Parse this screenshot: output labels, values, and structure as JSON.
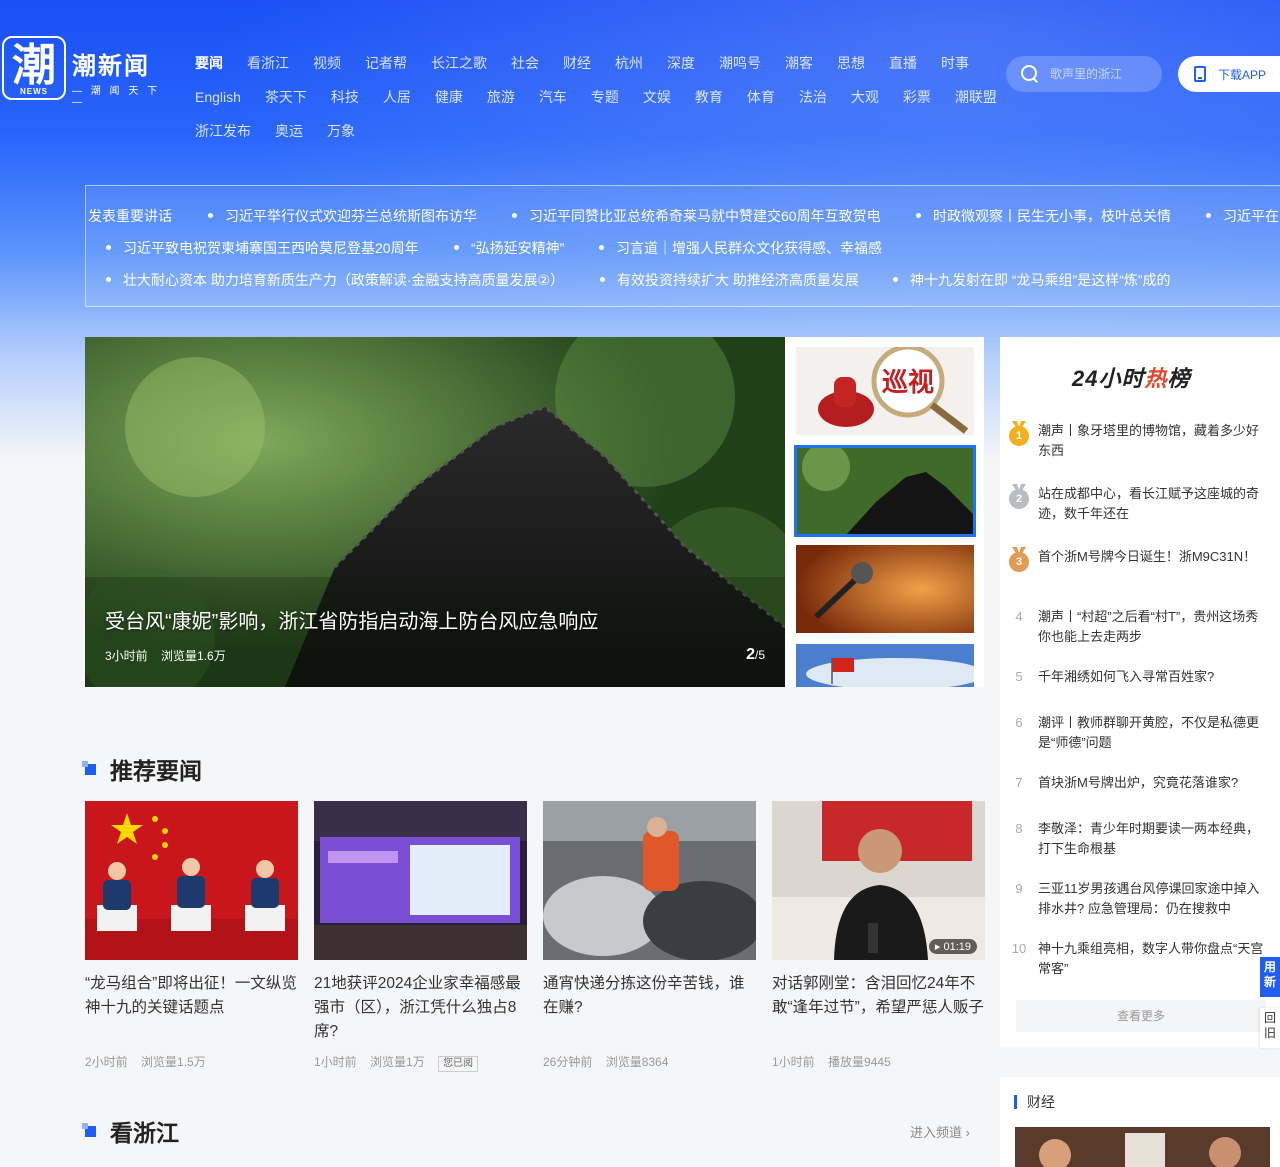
{
  "brand": {
    "logo_char": "潮",
    "logo_tag": "NEWS",
    "name": "潮新闻",
    "slogan": "— 潮 闻 天 下 —"
  },
  "nav": {
    "row1": [
      "要闻",
      "看浙江",
      "视频",
      "记者帮",
      "长江之歌",
      "社会",
      "财经",
      "杭州",
      "深度",
      "潮鸣号",
      "潮客",
      "思想",
      "直播",
      "时事"
    ],
    "row2": [
      "English",
      "茶天下",
      "科技",
      "人居",
      "健康",
      "旅游",
      "汽车",
      "专题",
      "文娱",
      "教育",
      "体育",
      "法治",
      "大观",
      "彩票",
      "潮联盟"
    ],
    "row3": [
      "浙江发布",
      "奥运",
      "万象"
    ],
    "active": "要闻"
  },
  "search": {
    "placeholder": "歌声里的浙江"
  },
  "download": {
    "label": "下载APP"
  },
  "ticker": {
    "row1": [
      "发表重要讲话",
      "习近平举行仪式欢迎芬兰总统斯图布访华",
      "习近平同赞比亚总统希奇莱马就中赞建交60周年互致贺电",
      "时政微观察丨民生无小事，枝叶总关情",
      "习近平在"
    ],
    "row2": [
      "习近平致电祝贺柬埔寨国王西哈莫尼登基20周年",
      "“弘扬延安精神”",
      "习言道｜增强人民群众文化获得感、幸福感"
    ],
    "row3": [
      "壮大耐心资本 助力培育新质生产力（政策解读·金融支持高质量发展②）",
      "有效投资持续扩大 助推经济高质量发展",
      "神十九发射在即 “龙马乘组”是这样“炼”成的"
    ]
  },
  "carousel": {
    "title": "受台风“康妮”影响，浙江省防指启动海上防台风应急响应",
    "time": "3小时前",
    "views": "浏览量1.6万",
    "page_current": "2",
    "page_total": "/5",
    "thumb1_text": "巡视"
  },
  "recommend": {
    "heading": "推荐要闻",
    "cards": [
      {
        "title": "“龙马组合”即将出征！一文纵览神十九的关键话题点",
        "time": "2小时前",
        "stat": "浏览量1.5万",
        "badge": "",
        "duration": ""
      },
      {
        "title": "21地获评2024企业家幸福感最强市（区），浙江凭什么独占8席?",
        "time": "1小时前",
        "stat": "浏览量1万",
        "badge": "您已阅",
        "duration": ""
      },
      {
        "title": "通宵快递分拣这份辛苦钱，谁在赚?",
        "time": "26分钟前",
        "stat": "浏览量8364",
        "badge": "",
        "duration": ""
      },
      {
        "title": "对话郭刚堂：含泪回忆24年不敢“逢年过节”，希望严惩人贩子",
        "time": "1小时前",
        "stat": "播放量9445",
        "badge": "",
        "duration": "01:19"
      }
    ]
  },
  "zhejiang": {
    "heading": "看浙江",
    "enter": "进入频道"
  },
  "hot": {
    "title_a": "24小时",
    "title_b": "热",
    "title_c": "榜",
    "items": [
      {
        "rank": "1",
        "text": "潮声丨象牙塔里的博物馆，藏着多少好东西"
      },
      {
        "rank": "2",
        "text": "站在成都中心，看长江赋予这座城的奇迹，数千年还在"
      },
      {
        "rank": "3",
        "text": "首个浙M号牌今日诞生！浙M9C31N！"
      },
      {
        "rank": "4",
        "text": "潮声丨“村超”之后看“村T”，贵州这场秀你也能上去走两步"
      },
      {
        "rank": "5",
        "text": "千年湘绣如何飞入寻常百姓家?"
      },
      {
        "rank": "6",
        "text": "潮评丨教师群聊开黄腔，不仅是私德更是“师德”问题"
      },
      {
        "rank": "7",
        "text": "首块浙M号牌出炉，究竟花落谁家?"
      },
      {
        "rank": "8",
        "text": "李敬泽：青少年时期要读一两本经典，打下生命根基"
      },
      {
        "rank": "9",
        "text": "三亚11岁男孩遇台风停课回家途中掉入排水井? 应急管理局：仍在搜救中"
      },
      {
        "rank": "10",
        "text": "神十九乘组亮相，数字人带你盘点“天宫常客”"
      }
    ],
    "more": "查看更多"
  },
  "side_tabs": {
    "use_new": "用新",
    "back_old": "回旧"
  },
  "finance": {
    "title": "财经"
  },
  "colors": {
    "brand_blue": "#1f5df5",
    "gold": "#f2b01e",
    "silver": "#b9bcc2",
    "bronze": "#e49a52"
  }
}
